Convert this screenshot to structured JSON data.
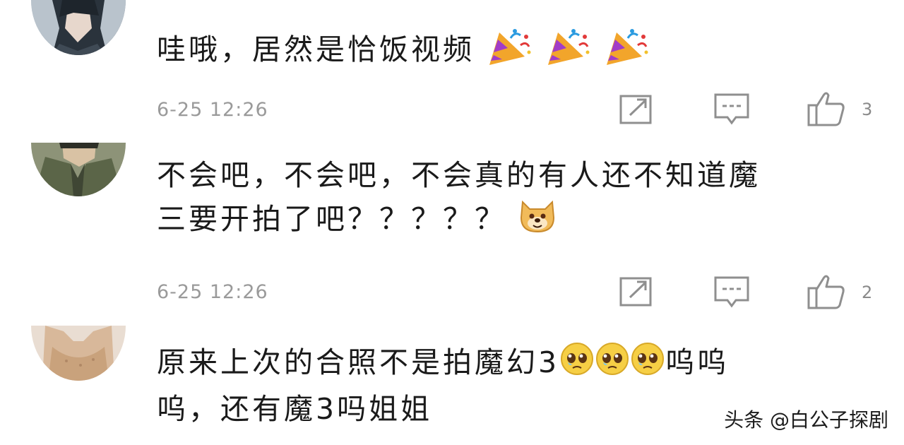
{
  "comments": [
    {
      "text": "哇哦，居然是恰饭视频",
      "emojis": [
        "party-popper",
        "party-popper",
        "party-popper"
      ],
      "date": "6-25 12:26",
      "likes": "3"
    },
    {
      "text_line1": "不会吧，不会吧，不会真的有人还不知道魔",
      "text_line2": "三要开拍了吧？？？？？",
      "emojis": [
        "doge"
      ],
      "date": "6-25 12:26",
      "likes": "2"
    },
    {
      "text_line1a": "原来上次的合照不是拍魔幻3",
      "text_line1b": "呜呜",
      "text_line2": "呜，还有魔3吗姐姐",
      "emojis": [
        "pleading-face",
        "pleading-face",
        "pleading-face"
      ]
    }
  ],
  "watermark": "头条 @白公子探剧"
}
